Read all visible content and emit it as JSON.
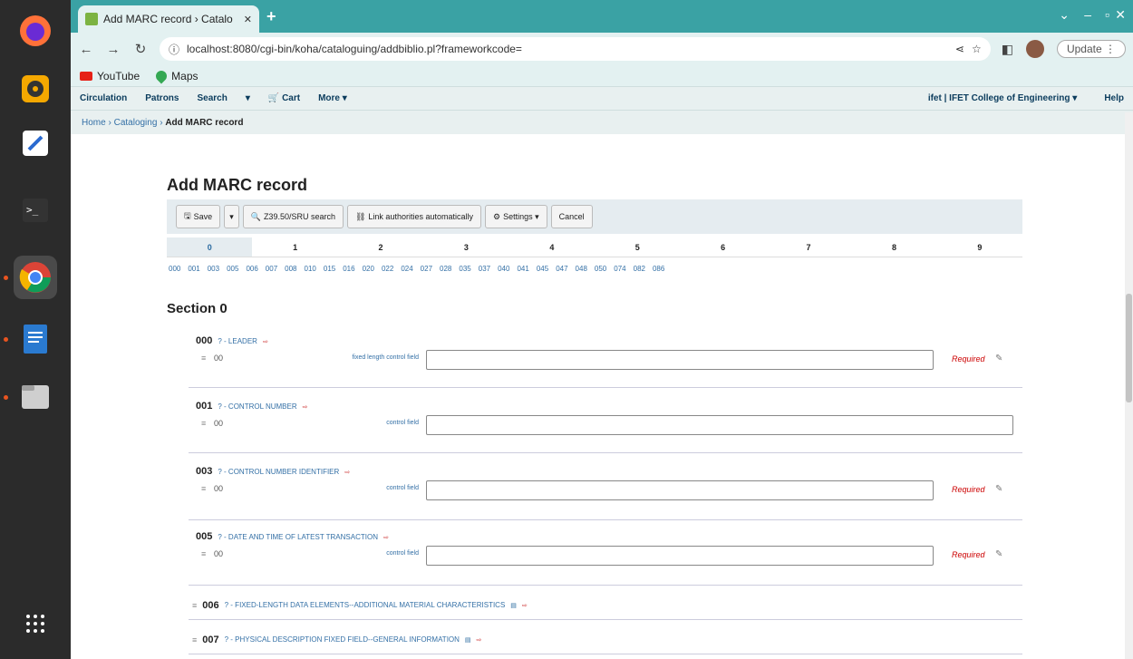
{
  "browser": {
    "tab_title": "Add MARC record › Catalo",
    "tab_close": "✕",
    "new_tab": "+",
    "url": "localhost:8080/cgi-bin/koha/cataloguing/addbiblio.pl?frameworkcode=",
    "update_label": "Update",
    "bookmarks": [
      "YouTube",
      "Maps"
    ]
  },
  "koha_nav": {
    "items": [
      "Circulation",
      "Patrons",
      "Search",
      "▾",
      "🛒 Cart",
      "More ▾"
    ],
    "library": "ifet | IFET College of Engineering ▾",
    "help": "Help"
  },
  "breadcrumb": {
    "home": "Home",
    "cataloging": "Cataloging",
    "current": "Add MARC record",
    "sep": "›"
  },
  "page": {
    "title": "Add MARC record",
    "section_title": "Section 0"
  },
  "toolbar": {
    "save": "Save",
    "caret": "▾",
    "z3950": "Z39.50/SRU search",
    "link_auth": "Link authorities automatically",
    "settings": "Settings ▾",
    "cancel": "Cancel"
  },
  "framework_tabs": [
    "0",
    "1",
    "2",
    "3",
    "4",
    "5",
    "6",
    "7",
    "8",
    "9"
  ],
  "tag_links": [
    "000",
    "001",
    "003",
    "005",
    "006",
    "007",
    "008",
    "010",
    "015",
    "016",
    "020",
    "022",
    "024",
    "027",
    "028",
    "035",
    "037",
    "040",
    "041",
    "045",
    "047",
    "048",
    "050",
    "074",
    "082",
    "086"
  ],
  "fields": [
    {
      "tag": "000",
      "name": "? - LEADER",
      "code": "00",
      "label": "fixed length control field",
      "required": "Required"
    },
    {
      "tag": "001",
      "name": "? - CONTROL NUMBER",
      "code": "00",
      "label": "control field",
      "required": ""
    },
    {
      "tag": "003",
      "name": "? - CONTROL NUMBER IDENTIFIER",
      "code": "00",
      "label": "control field",
      "required": "Required"
    },
    {
      "tag": "005",
      "name": "? - DATE AND TIME OF LATEST TRANSACTION",
      "code": "00",
      "label": "control field",
      "required": "Required"
    }
  ],
  "collapsed_fields": [
    {
      "tag": "006",
      "name": "? - FIXED-LENGTH DATA ELEMENTS--ADDITIONAL MATERIAL CHARACTERISTICS"
    },
    {
      "tag": "007",
      "name": "? - PHYSICAL DESCRIPTION FIXED FIELD--GENERAL INFORMATION"
    }
  ],
  "colors": {
    "accent": "#3aa2a4",
    "link": "#3470a6",
    "required": "#cc0000"
  }
}
